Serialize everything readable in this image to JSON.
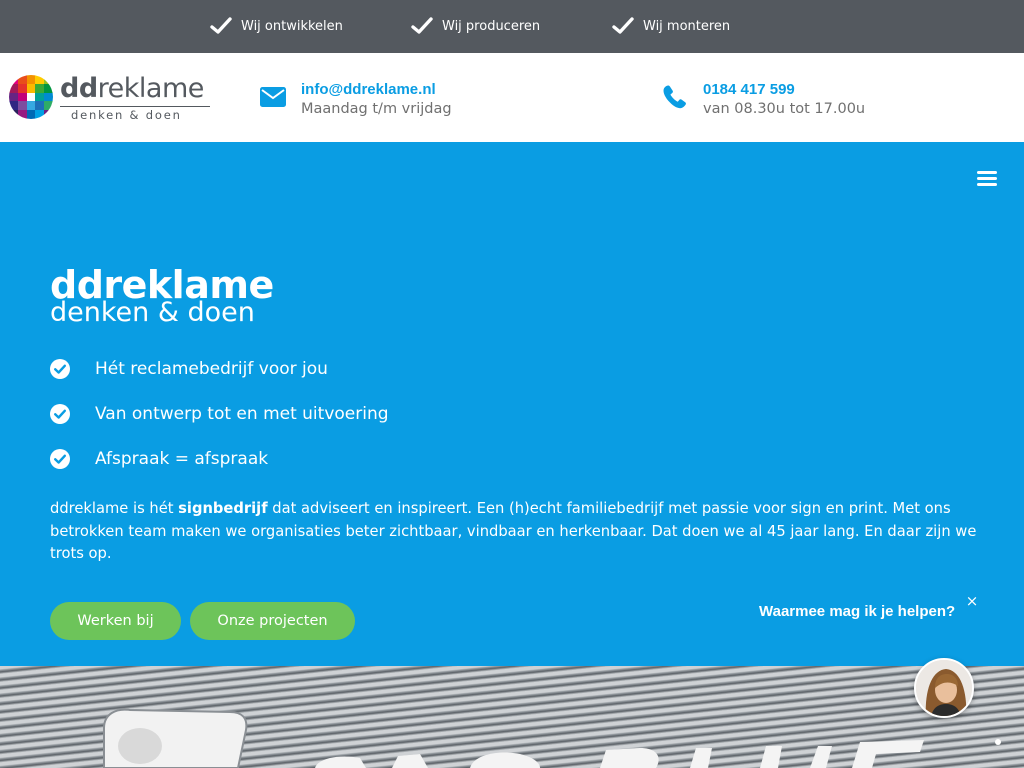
{
  "topbar": {
    "usps": [
      {
        "label": "Wij ontwikkelen",
        "icon": "checkmark-icon"
      },
      {
        "label": "Wij produceren",
        "icon": "checkmark-icon"
      },
      {
        "label": "Wij monteren",
        "icon": "checkmark-icon"
      }
    ]
  },
  "header": {
    "logo": {
      "word_bold": "dd",
      "word_rest": "reklame",
      "tagline": "denken & doen"
    },
    "email": {
      "address": "info@ddreklame.nl",
      "hours": "Maandag t/m vrijdag",
      "icon": "envelope-icon"
    },
    "phone": {
      "number": "0184 417 599",
      "hours": "van 08.30u tot 17.00u",
      "icon": "phone-icon"
    }
  },
  "hero": {
    "title": "ddreklame",
    "subtitle": "denken & doen",
    "features": [
      "Hét reclamebedrijf voor jou",
      "Van ontwerp tot en met uitvoering",
      "Afspraak = afspraak"
    ],
    "intro_before": "ddreklame is hét ",
    "intro_bold": "signbedrijf",
    "intro_after": " dat adviseert en inspireert. Een (h)echt familiebedrijf met passie voor sign en print. Met ons betrokken team maken we organisaties beter zichtbaar, vindbaar en herkenbaar. Dat doen we al 45 jaar lang. En daar zijn we trots op.",
    "buttons": {
      "werken_bij": "Werken bij",
      "projecten": "Onze projecten"
    }
  },
  "chat": {
    "prompt": "Waarmee mag ik je helpen?",
    "close": "×"
  },
  "colors": {
    "brand_blue": "#0a9de3",
    "topbar_gray": "#54595f",
    "button_green": "#6dc45a",
    "text_gray": "#707070"
  }
}
